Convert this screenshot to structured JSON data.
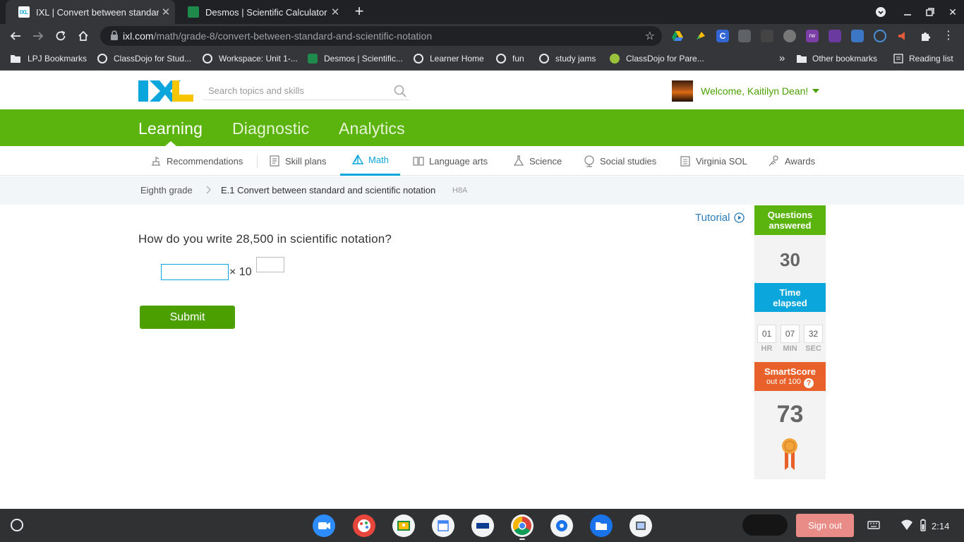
{
  "browser": {
    "tabs": [
      {
        "title": "IXL | Convert between standard and scientific notation",
        "fav_label": "IXL",
        "fav_color": "#ffffff"
      },
      {
        "title": "Desmos | Scientific Calculator",
        "fav_label": "",
        "fav_color": "#1e8a4c"
      }
    ],
    "url_host": "ixl.com",
    "url_path": "/math/grade-8/convert-between-standard-and-scientific-notation",
    "extensions": [
      {
        "icon": "google-drive-icon",
        "color": "#f4b400"
      },
      {
        "icon": "keep-icon",
        "color": "#fbbc04"
      },
      {
        "icon": "c-icon",
        "color": "#3367d6"
      },
      {
        "icon": "copy-icon",
        "color": "#5f6368"
      },
      {
        "icon": "grid-icon",
        "color": "#444"
      },
      {
        "icon": "chat-icon",
        "color": "#777"
      },
      {
        "icon": "rw-icon",
        "color": "#7b3fa7"
      },
      {
        "icon": "doc-icon",
        "color": "#6a3aa0"
      },
      {
        "icon": "new-ext-icon",
        "color": "#3b77c5"
      },
      {
        "icon": "circle-icon",
        "color": "#4a90d9"
      },
      {
        "icon": "speaker-icon",
        "color": "#e45d3a"
      }
    ],
    "bookmarks": [
      {
        "label": "LPJ Bookmarks",
        "color": "#e8eaed"
      },
      {
        "label": "ClassDojo for Stud...",
        "color": "#e8eaed"
      },
      {
        "label": "Workspace: Unit 1-...",
        "color": "#e8eaed"
      },
      {
        "label": "Desmos | Scientific...",
        "color": "#1e8a4c"
      },
      {
        "label": "Learner Home",
        "color": "#e8eaed"
      },
      {
        "label": "fun",
        "color": "#e8eaed"
      },
      {
        "label": "study jams",
        "color": "#e8eaed"
      },
      {
        "label": "ClassDojo for Pare...",
        "color": "#9ac33b"
      }
    ],
    "other_bookmarks": "Other bookmarks",
    "reading_list": "Reading list",
    "more": "»"
  },
  "header": {
    "search_placeholder": "Search topics and skills",
    "welcome": "Welcome, Kaitilyn Dean!"
  },
  "main_nav": [
    "Learning",
    "Diagnostic",
    "Analytics"
  ],
  "sub_nav": [
    {
      "label": "Recommendations"
    },
    {
      "label": "Skill plans"
    },
    {
      "label": "Math"
    },
    {
      "label": "Language arts"
    },
    {
      "label": "Science"
    },
    {
      "label": "Social studies"
    },
    {
      "label": "Virginia SOL"
    },
    {
      "label": "Awards"
    }
  ],
  "breadcrumb": {
    "grade": "Eighth grade",
    "skill": "E.1 Convert between standard and scientific notation",
    "code": "H8A"
  },
  "question": {
    "prompt": "How do you write 28,500 in scientific notation?",
    "times_text": "× 10",
    "coefficient_value": "",
    "exponent_value": "",
    "submit_label": "Submit"
  },
  "tutorial_label": "Tutorial",
  "stats": {
    "questions_label_1": "Questions",
    "questions_label_2": "answered",
    "questions_count": "30",
    "time_label_1": "Time",
    "time_label_2": "elapsed",
    "hours": "01",
    "minutes": "07",
    "seconds": "32",
    "hr_label": "HR",
    "min_label": "MIN",
    "sec_label": "SEC",
    "smartscore_label": "SmartScore",
    "smartscore_sub": "out of 100",
    "help": "?",
    "smartscore": "73"
  },
  "colors": {
    "green": "#5bb40e",
    "blue": "#0aa6dc",
    "orange": "#e9612a"
  },
  "shelf": {
    "apps": [
      {
        "icon": "zoom-icon",
        "color": "#2d8cff"
      },
      {
        "icon": "paint-icon",
        "color": "#e8453c"
      },
      {
        "icon": "classroom-icon",
        "color": "#f1f3f4"
      },
      {
        "icon": "calendar-icon",
        "color": "#f1f3f4"
      },
      {
        "icon": "pearson-icon",
        "color": "#f1f3f4"
      },
      {
        "icon": "chrome-icon",
        "color": "#f1f3f4"
      },
      {
        "icon": "settings-icon",
        "color": "#f1f3f4"
      },
      {
        "icon": "files-icon",
        "color": "#1a73e8"
      },
      {
        "icon": "screenshot-icon",
        "color": "#f1f3f4"
      }
    ],
    "sign_out": "Sign out",
    "time": "2:14"
  }
}
